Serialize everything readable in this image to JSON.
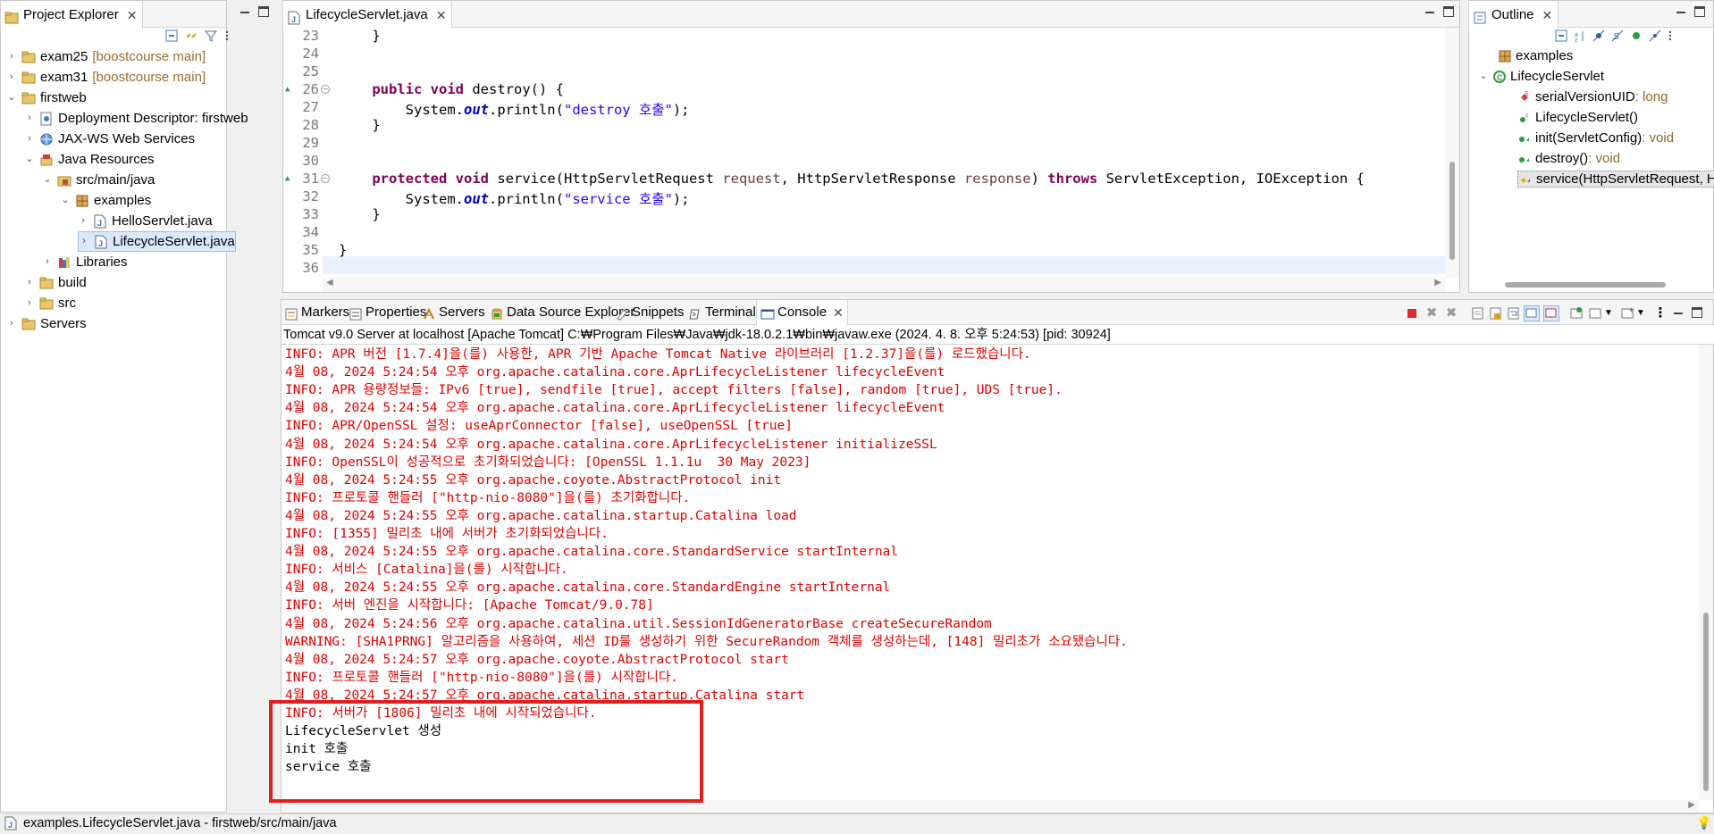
{
  "project_explorer": {
    "title": "Project Explorer",
    "tree": [
      {
        "label": "exam25",
        "decoration": "[boostcourse main]",
        "twisty": "›",
        "icon": "project-icon"
      },
      {
        "label": "exam31",
        "decoration": "[boostcourse main]",
        "twisty": "›",
        "icon": "project-icon"
      },
      {
        "label": "firstweb",
        "decoration": "",
        "twisty": "⌄",
        "icon": "project-icon"
      },
      {
        "label": "Deployment Descriptor: firstweb",
        "decoration": "",
        "twisty": "›",
        "icon": "descriptor-icon"
      },
      {
        "label": "JAX-WS Web Services",
        "decoration": "",
        "twisty": "›",
        "icon": "webservice-icon"
      },
      {
        "label": "Java Resources",
        "decoration": "",
        "twisty": "⌄",
        "icon": "java-resources-icon"
      },
      {
        "label": "src/main/java",
        "decoration": "",
        "twisty": "⌄",
        "icon": "source-folder-icon"
      },
      {
        "label": "examples",
        "decoration": "",
        "twisty": "⌄",
        "icon": "package-icon"
      },
      {
        "label": "HelloServlet.java",
        "decoration": "",
        "twisty": "›",
        "icon": "java-file-icon"
      },
      {
        "label": "LifecycleServlet.java",
        "decoration": "",
        "twisty": "›",
        "icon": "java-file-icon"
      },
      {
        "label": "Libraries",
        "decoration": "",
        "twisty": "›",
        "icon": "library-icon"
      },
      {
        "label": "build",
        "decoration": "",
        "twisty": "›",
        "icon": "folder-icon"
      },
      {
        "label": "src",
        "decoration": "",
        "twisty": "›",
        "icon": "folder-icon"
      },
      {
        "label": "Servers",
        "decoration": "",
        "twisty": "›",
        "icon": "folder-icon"
      }
    ]
  },
  "editor": {
    "tab_label": "LifecycleServlet.java",
    "lines": [
      {
        "num": "23",
        "text": "    }"
      },
      {
        "num": "24",
        "text": ""
      },
      {
        "num": "25",
        "text": ""
      },
      {
        "num": "26",
        "text": "    public void destroy() {"
      },
      {
        "num": "27",
        "text": "        System.out.println(\"destroy 호출\");"
      },
      {
        "num": "28",
        "text": "    }"
      },
      {
        "num": "29",
        "text": ""
      },
      {
        "num": "30",
        "text": ""
      },
      {
        "num": "31",
        "text": "    protected void service(HttpServletRequest request, HttpServletResponse response) throws ServletException, IOException {"
      },
      {
        "num": "32",
        "text": "        System.out.println(\"service 호출\");"
      },
      {
        "num": "33",
        "text": "    }"
      },
      {
        "num": "34",
        "text": ""
      },
      {
        "num": "35",
        "text": "}"
      },
      {
        "num": "36",
        "text": ""
      }
    ]
  },
  "outline": {
    "title": "Outline",
    "items": [
      {
        "label": "examples",
        "type": "",
        "icon": "package-icon"
      },
      {
        "label": "LifecycleServlet",
        "type": "",
        "icon": "class-icon"
      },
      {
        "label": "serialVersionUID",
        "type": " : long",
        "icon": "static-field-icon"
      },
      {
        "label": "LifecycleServlet()",
        "type": "",
        "icon": "constructor-icon"
      },
      {
        "label": "init(ServletConfig)",
        "type": " : void",
        "icon": "public-method-icon"
      },
      {
        "label": "destroy()",
        "type": " : void",
        "icon": "public-method-icon"
      },
      {
        "label": "service(HttpServletRequest, Ht",
        "type": "",
        "icon": "protected-method-icon"
      }
    ]
  },
  "bottom_tabs": [
    {
      "label": "Markers",
      "icon": "markers-icon"
    },
    {
      "label": "Properties",
      "icon": "properties-icon"
    },
    {
      "label": "Servers",
      "icon": "servers-icon"
    },
    {
      "label": "Data Source Explorer",
      "icon": "datasource-icon"
    },
    {
      "label": "Snippets",
      "icon": "snippets-icon"
    },
    {
      "label": "Terminal",
      "icon": "terminal-icon"
    },
    {
      "label": "Console",
      "icon": "console-icon"
    }
  ],
  "console": {
    "header": "Tomcat v9.0 Server at localhost [Apache Tomcat] C:₩Program Files₩Java₩jdk-18.0.2.1₩bin₩javaw.exe  (2024. 4. 8. 오후 5:24:53) [pid: 30924]",
    "lines": [
      {
        "text": "INFO: APR 버전 [1.7.4]을(를) 사용한, APR 기반 Apache Tomcat Native 라이브러리 [1.2.37]을(를) 로드했습니다.",
        "kind": "err"
      },
      {
        "text": "4월 08, 2024 5:24:54 오후 org.apache.catalina.core.AprLifecycleListener lifecycleEvent",
        "kind": "err"
      },
      {
        "text": "INFO: APR 용량정보들: IPv6 [true], sendfile [true], accept filters [false], random [true], UDS [true].",
        "kind": "err"
      },
      {
        "text": "4월 08, 2024 5:24:54 오후 org.apache.catalina.core.AprLifecycleListener lifecycleEvent",
        "kind": "err"
      },
      {
        "text": "INFO: APR/OpenSSL 설정: useAprConnector [false], useOpenSSL [true]",
        "kind": "err"
      },
      {
        "text": "4월 08, 2024 5:24:54 오후 org.apache.catalina.core.AprLifecycleListener initializeSSL",
        "kind": "err"
      },
      {
        "text": "INFO: OpenSSL이 성공적으로 초기화되었습니다: [OpenSSL 1.1.1u  30 May 2023]",
        "kind": "err"
      },
      {
        "text": "4월 08, 2024 5:24:55 오후 org.apache.coyote.AbstractProtocol init",
        "kind": "err"
      },
      {
        "text": "INFO: 프로토콜 핸들러 [\"http-nio-8080\"]을(를) 초기화합니다.",
        "kind": "err"
      },
      {
        "text": "4월 08, 2024 5:24:55 오후 org.apache.catalina.startup.Catalina load",
        "kind": "err"
      },
      {
        "text": "INFO: [1355] 밀리초 내에 서버가 초기화되었습니다.",
        "kind": "err"
      },
      {
        "text": "4월 08, 2024 5:24:55 오후 org.apache.catalina.core.StandardService startInternal",
        "kind": "err"
      },
      {
        "text": "INFO: 서비스 [Catalina]을(를) 시작합니다.",
        "kind": "err"
      },
      {
        "text": "4월 08, 2024 5:24:55 오후 org.apache.catalina.core.StandardEngine startInternal",
        "kind": "err"
      },
      {
        "text": "INFO: 서버 엔진을 시작합니다: [Apache Tomcat/9.0.78]",
        "kind": "err"
      },
      {
        "text": "4월 08, 2024 5:24:56 오후 org.apache.catalina.util.SessionIdGeneratorBase createSecureRandom",
        "kind": "err"
      },
      {
        "text": "WARNING: [SHA1PRNG] 알고리즘을 사용하여, 세션 ID를 생성하기 위한 SecureRandom 객체를 생성하는데, [148] 밀리초가 소요됐습니다.",
        "kind": "err"
      },
      {
        "text": "4월 08, 2024 5:24:57 오후 org.apache.coyote.AbstractProtocol start",
        "kind": "err"
      },
      {
        "text": "INFO: 프로토콜 핸들러 [\"http-nio-8080\"]을(를) 시작합니다.",
        "kind": "err"
      },
      {
        "text": "4월 08, 2024 5:24:57 오후 org.apache.catalina.startup.Catalina start",
        "kind": "err"
      },
      {
        "text": "INFO: 서버가 [1806] 밀리초 내에 시작되었습니다.",
        "kind": "err"
      },
      {
        "text": "LifecycleServlet 생성",
        "kind": "out"
      },
      {
        "text": "init 호출",
        "kind": "out"
      },
      {
        "text": "service 호출",
        "kind": "out"
      }
    ]
  },
  "status_bar": {
    "text": "examples.LifecycleServlet.java - firstweb/src/main/java"
  },
  "colors": {
    "stderr": "#e00000",
    "keyword": "#7f0055",
    "string": "#2a00ff",
    "highlight_box": "#e02020",
    "selection": "#dbe9fb"
  }
}
